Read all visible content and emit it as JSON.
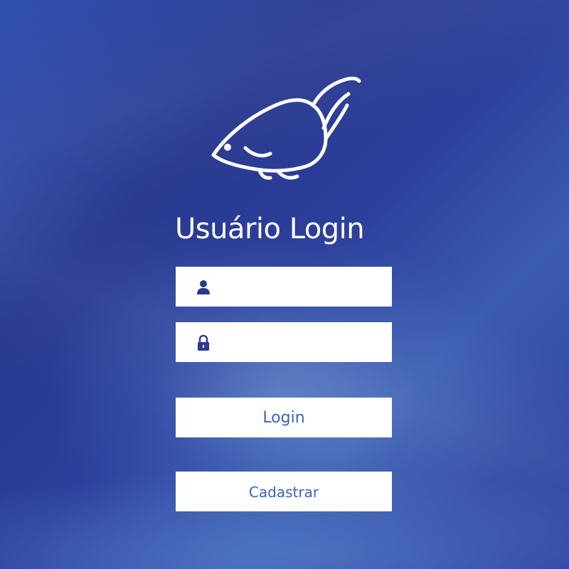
{
  "login_form": {
    "title": "Usuário Login",
    "username": {
      "value": "",
      "placeholder": "",
      "icon": "user-icon"
    },
    "password": {
      "value": "",
      "placeholder": "",
      "icon": "lock-icon"
    },
    "login_button_label": "Login",
    "register_button_label": "Cadastrar"
  },
  "colors": {
    "background": "#2c3f9a",
    "field_background": "#ffffff",
    "icon": "#2b3a8f",
    "button_text": "#3a64b8",
    "title_text": "#ffffff"
  },
  "logo": {
    "icon": "fish-logo-icon"
  }
}
